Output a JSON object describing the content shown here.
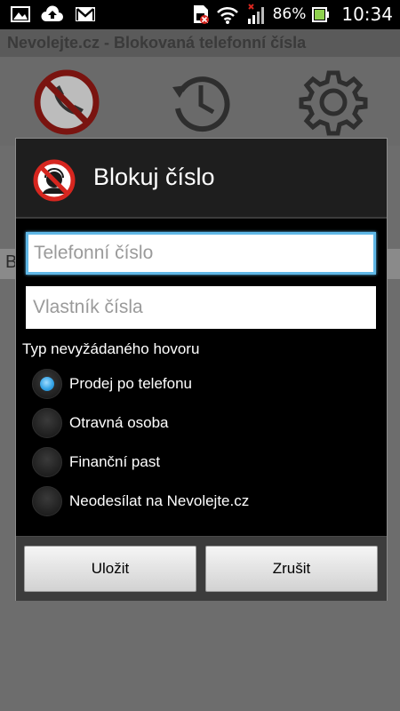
{
  "status_bar": {
    "battery_percent": "86%",
    "time": "10:34",
    "left_icons": [
      "image-icon",
      "cloud-upload-icon",
      "gmail-icon"
    ],
    "right_icons": [
      "sim-blocked-icon",
      "wifi-icon",
      "signal-icon",
      "battery-icon"
    ]
  },
  "app": {
    "title": "Nevolejte.cz - Blokovaná telefonní čísla",
    "background_row_letter": "B",
    "toolbar_icons": [
      "blocked-call-icon",
      "history-icon",
      "settings-gear-icon"
    ]
  },
  "dialog": {
    "title": "Blokuj číslo",
    "phone_placeholder": "Telefonní číslo",
    "owner_placeholder": "Vlastník čísla",
    "section_label": "Typ nevyžádaného hovoru",
    "options": [
      {
        "label": "Prodej po telefonu",
        "checked": true
      },
      {
        "label": "Otravná osoba",
        "checked": false
      },
      {
        "label": "Finanční past",
        "checked": false
      },
      {
        "label": "Neodesílat na Nevolejte.cz",
        "checked": false
      }
    ],
    "save_label": "Uložit",
    "cancel_label": "Zrušit"
  },
  "colors": {
    "accent": "#36a4e6",
    "focus": "#5fb7e6",
    "blocked_red": "#d6261f"
  }
}
